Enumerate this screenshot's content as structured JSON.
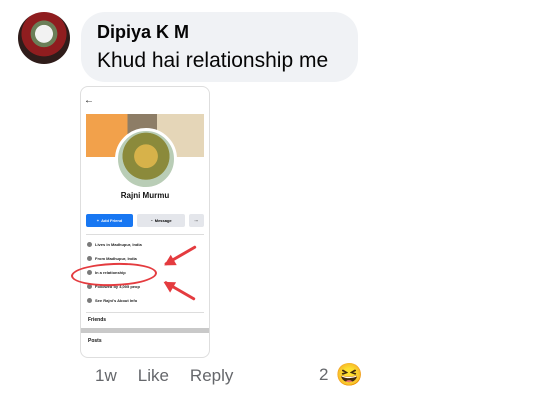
{
  "comment": {
    "author": "Dipiya K M",
    "text": "Khud hai relationship me"
  },
  "embedded": {
    "status_left": "",
    "status_right": "",
    "profile_name": "Rajni Murmu",
    "buttons": {
      "add_friend": "Add Friend",
      "message": "Message",
      "more": "···"
    },
    "info": [
      {
        "icon": "home-icon",
        "text": "Lives in Madhupur, India"
      },
      {
        "icon": "location-icon",
        "text": "From Madhupur, India"
      },
      {
        "icon": "heart-icon",
        "text": "In a relationship"
      },
      {
        "icon": "followers-icon",
        "text": "Followed by 4,005 peop"
      },
      {
        "icon": "more-icon",
        "text": "See Rajni's About Info"
      }
    ],
    "sections": {
      "friends": "Friends",
      "posts": "Posts"
    },
    "colors": {
      "facebook_blue": "#1877f2",
      "annotation_red": "#e43b3f"
    }
  },
  "actions": {
    "time": "1w",
    "like": "Like",
    "reply": "Reply",
    "reaction_count": "2",
    "reaction_emoji": "😆"
  }
}
